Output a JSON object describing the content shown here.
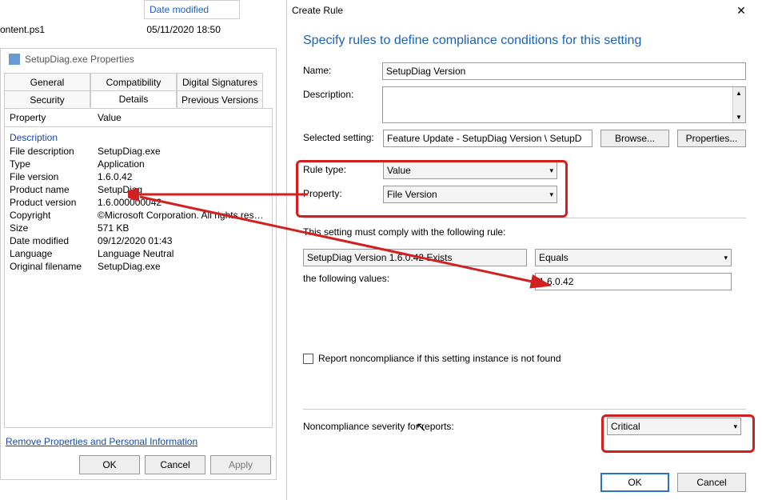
{
  "explorer": {
    "col_date_header": "Date modified",
    "file_name": "ontent.ps1",
    "file_date": "05/11/2020 18:50"
  },
  "props": {
    "title": "SetupDiag.exe Properties",
    "tabs": {
      "general": "General",
      "compatibility": "Compatibility",
      "digital": "Digital Signatures",
      "security": "Security",
      "details": "Details",
      "previous": "Previous Versions"
    },
    "headers": {
      "property": "Property",
      "value": "Value"
    },
    "section": "Description",
    "rows": {
      "file_desc_l": "File description",
      "file_desc_v": "SetupDiag.exe",
      "type_l": "Type",
      "type_v": "Application",
      "filever_l": "File version",
      "filever_v": "1.6.0.42",
      "prodname_l": "Product name",
      "prodname_v": "SetupDiag",
      "prodver_l": "Product version",
      "prodver_v": "1.6.000000042",
      "copy_l": "Copyright",
      "copy_v": "©Microsoft Corporation.  All rights reserv...",
      "size_l": "Size",
      "size_v": "571 KB",
      "datemod_l": "Date modified",
      "datemod_v": "09/12/2020 01:43",
      "lang_l": "Language",
      "lang_v": "Language Neutral",
      "orig_l": "Original filename",
      "orig_v": "SetupDiag.exe"
    },
    "link": "Remove Properties and Personal Information",
    "buttons": {
      "ok": "OK",
      "cancel": "Cancel",
      "apply": "Apply"
    }
  },
  "rule": {
    "title": "Create Rule",
    "heading": "Specify rules to define compliance conditions for this setting",
    "labels": {
      "name": "Name:",
      "desc": "Description:",
      "selected": "Selected setting:",
      "ruletype": "Rule type:",
      "property": "Property:",
      "comply": "This setting must comply with the following rule:",
      "following": "the following values:",
      "report": "Report noncompliance if this setting instance is not found",
      "severity": "Noncompliance severity for reports:"
    },
    "values": {
      "name": "SetupDiag Version",
      "selected": "Feature Update - SetupDiag Version \\ SetupD",
      "ruletype": "Value",
      "property": "File Version",
      "rule_text": "SetupDiag Version 1.6.0.42 Exists",
      "operator": "Equals",
      "compare_value": "1.6.0.42",
      "severity": "Critical"
    },
    "buttons": {
      "browse": "Browse...",
      "properties": "Properties...",
      "ok": "OK",
      "cancel": "Cancel"
    }
  }
}
